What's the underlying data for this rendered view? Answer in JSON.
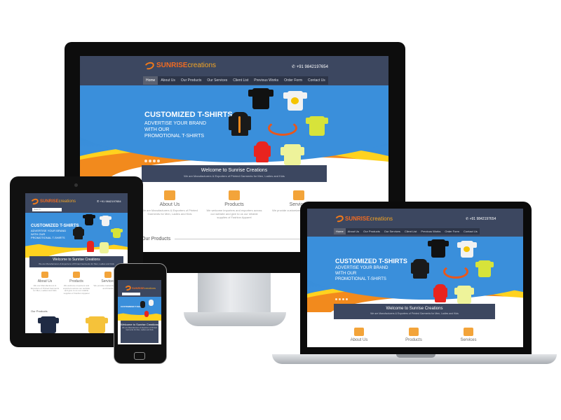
{
  "site": {
    "logo_bold": "SUNRISE",
    "logo_light": "creations",
    "phone": "+91 9842197654",
    "nav": [
      "Home",
      "About Us",
      "Our Products",
      "Our Services",
      "Client List",
      "Previous Works",
      "Order Form",
      "Contact Us"
    ],
    "hero_title": "CUSTOMIZED T-SHIRTS",
    "hero_line1": "ADVERTISE YOUR BRAND",
    "hero_line2": "WITH OUR",
    "hero_line3": "PROMOTIONAL T-SHIRTS",
    "welcome_title": "Welcome to Sunrise Creations",
    "welcome_text": "We are Manufacturers & Exporters of Printed Garments for Men, Ladies and Kids",
    "services": [
      {
        "label": "About Us",
        "text": "We are Manufacturers & Exporters of Printed Garments for Men, Ladies and Kids",
        "icon": "people-icon"
      },
      {
        "label": "Products",
        "text": "We welcome importers and exporters across our website and give to us our reliable supplies of Fashion Apparel",
        "icon": "box-icon"
      },
      {
        "label": "Services",
        "text": "We provide customized t-shirts and brands",
        "icon": "layers-icon"
      }
    ],
    "our_products": "Our Products",
    "search_placeholder": "Search..."
  },
  "colors": {
    "header": "#3c4760",
    "accent_orange": "#f26b21",
    "hero_blue": "#2f86d6",
    "hero_yellow": "#ffd21f"
  }
}
